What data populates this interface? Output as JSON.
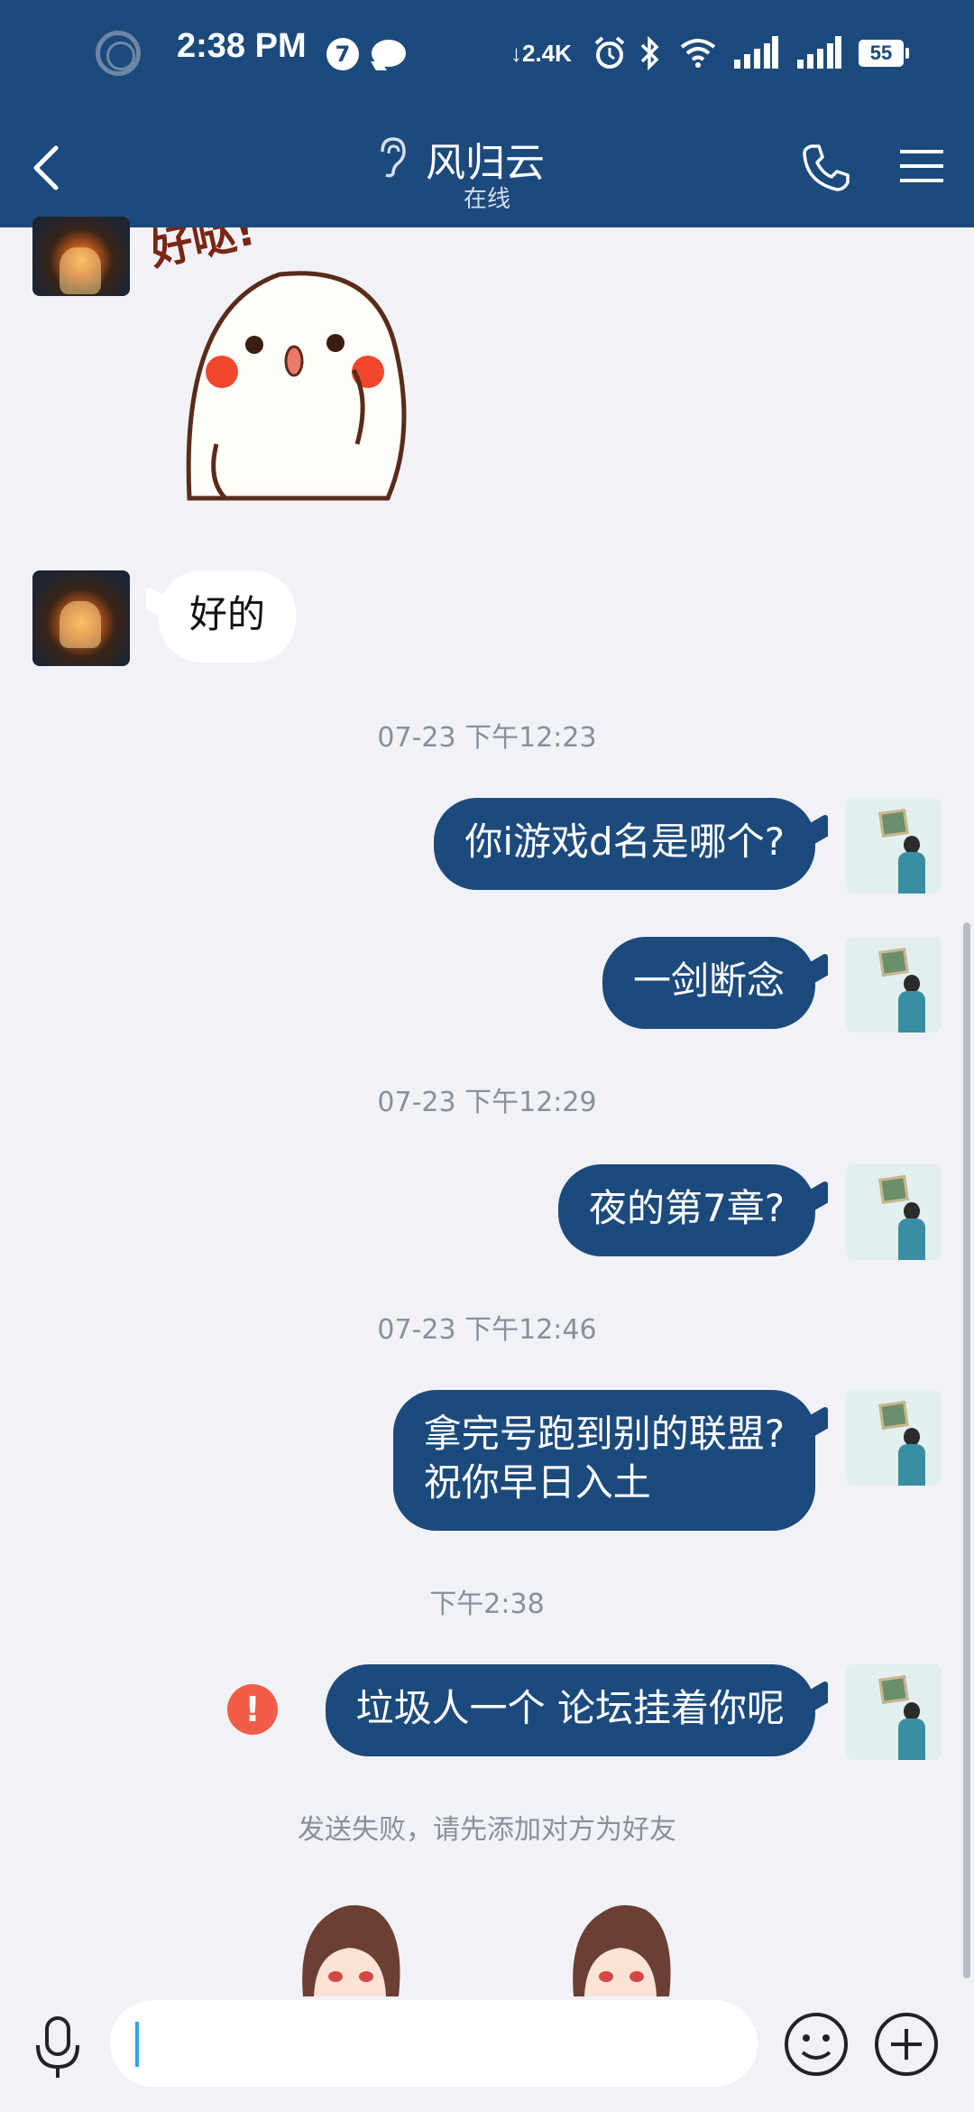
{
  "status_bar": {
    "time": "2:38 PM",
    "notification_count": "7",
    "net_speed": "2.4K",
    "battery": "55"
  },
  "header": {
    "contact_name": "风归云",
    "contact_status": "在线"
  },
  "messages": [
    {
      "type": "sticker",
      "side": "left",
      "sticker_text": "好哒!"
    },
    {
      "type": "text",
      "side": "left",
      "text": "好的"
    },
    {
      "type": "timestamp",
      "text": "07-23 下午12:23"
    },
    {
      "type": "text",
      "side": "right",
      "text": "你i游戏d名是哪个?"
    },
    {
      "type": "text",
      "side": "right",
      "text": "一剑断念"
    },
    {
      "type": "timestamp",
      "text": "07-23 下午12:29"
    },
    {
      "type": "text",
      "side": "right",
      "text": "夜的第7章?"
    },
    {
      "type": "timestamp",
      "text": "07-23 下午12:46"
    },
    {
      "type": "text",
      "side": "right",
      "lines": [
        "拿完号跑到别的联盟?",
        "祝你早日入土"
      ]
    },
    {
      "type": "timestamp",
      "text": "下午2:38"
    },
    {
      "type": "text",
      "side": "right",
      "text": "垃圾人一个 论坛挂着你呢",
      "failed": true,
      "error_glyph": "!"
    }
  ],
  "fail_notice": "发送失败，请先添加对方为好友",
  "input": {
    "value": "",
    "placeholder": ""
  },
  "colors": {
    "header_bg": "#1c4a7c",
    "outgoing_bubble": "#1c4a7c",
    "incoming_bubble": "#ffffff",
    "chat_bg": "#f1f2f7",
    "error": "#f25d48"
  },
  "icons": [
    "back-arrow-icon",
    "ear-icon",
    "phone-icon",
    "menu-icon",
    "mic-icon",
    "emoji-icon",
    "plus-icon",
    "error-icon"
  ]
}
